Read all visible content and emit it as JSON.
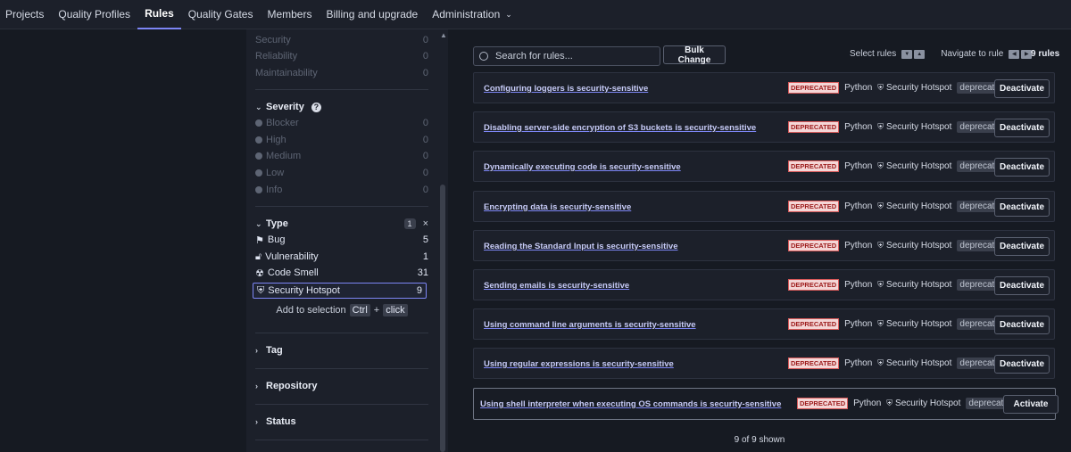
{
  "nav": {
    "items": [
      "Projects",
      "Quality Profiles",
      "Rules",
      "Quality Gates",
      "Members",
      "Billing and upgrade",
      "Administration"
    ],
    "active": "Rules"
  },
  "sidebar": {
    "top_items": [
      {
        "label": "Security",
        "count": "0"
      },
      {
        "label": "Reliability",
        "count": "0"
      },
      {
        "label": "Maintainability",
        "count": "0"
      }
    ],
    "severity": {
      "title": "Severity",
      "items": [
        {
          "label": "Blocker",
          "count": "0"
        },
        {
          "label": "High",
          "count": "0"
        },
        {
          "label": "Medium",
          "count": "0"
        },
        {
          "label": "Low",
          "count": "0"
        },
        {
          "label": "Info",
          "count": "0"
        }
      ]
    },
    "type": {
      "title": "Type",
      "badge": "1",
      "clear": "×",
      "items": [
        {
          "label": "Bug",
          "count": "5",
          "icon": "bug-icon"
        },
        {
          "label": "Vulnerability",
          "count": "1",
          "icon": "lock-icon"
        },
        {
          "label": "Code Smell",
          "count": "31",
          "icon": "code-smell-icon"
        },
        {
          "label": "Security Hotspot",
          "count": "9",
          "icon": "shield-icon"
        }
      ],
      "hint_prefix": "Add to selection",
      "hint_key": "Ctrl",
      "hint_plus": "+",
      "hint_action": "click"
    },
    "collapsed": [
      "Tag",
      "Repository",
      "Status"
    ]
  },
  "toolbar": {
    "search_placeholder": "Search for rules...",
    "bulk_change": "Bulk Change",
    "select_rules": "Select rules",
    "navigate_to_rule": "Navigate to rule",
    "total": "9 rules"
  },
  "rules": [
    {
      "title": "Configuring loggers is security-sensitive",
      "action": "Deactivate"
    },
    {
      "title": "Disabling server-side encryption of S3 buckets is security-sensitive",
      "action": "Deactivate"
    },
    {
      "title": "Dynamically executing code is security-sensitive",
      "action": "Deactivate"
    },
    {
      "title": "Encrypting data is security-sensitive",
      "action": "Deactivate"
    },
    {
      "title": "Reading the Standard Input is security-sensitive",
      "action": "Deactivate"
    },
    {
      "title": "Sending emails is security-sensitive",
      "action": "Deactivate"
    },
    {
      "title": "Using command line arguments is security-sensitive",
      "action": "Deactivate"
    },
    {
      "title": "Using regular expressions is security-sensitive",
      "action": "Deactivate"
    },
    {
      "title": "Using shell interpreter when executing OS commands is security-sensitive",
      "action": "Activate"
    }
  ],
  "rule_meta": {
    "deprecated_tag": "DEPRECATED",
    "language": "Python",
    "type": "Security Hotspot",
    "status": "deprecated"
  },
  "footer": {
    "shown": "9 of 9 shown"
  }
}
